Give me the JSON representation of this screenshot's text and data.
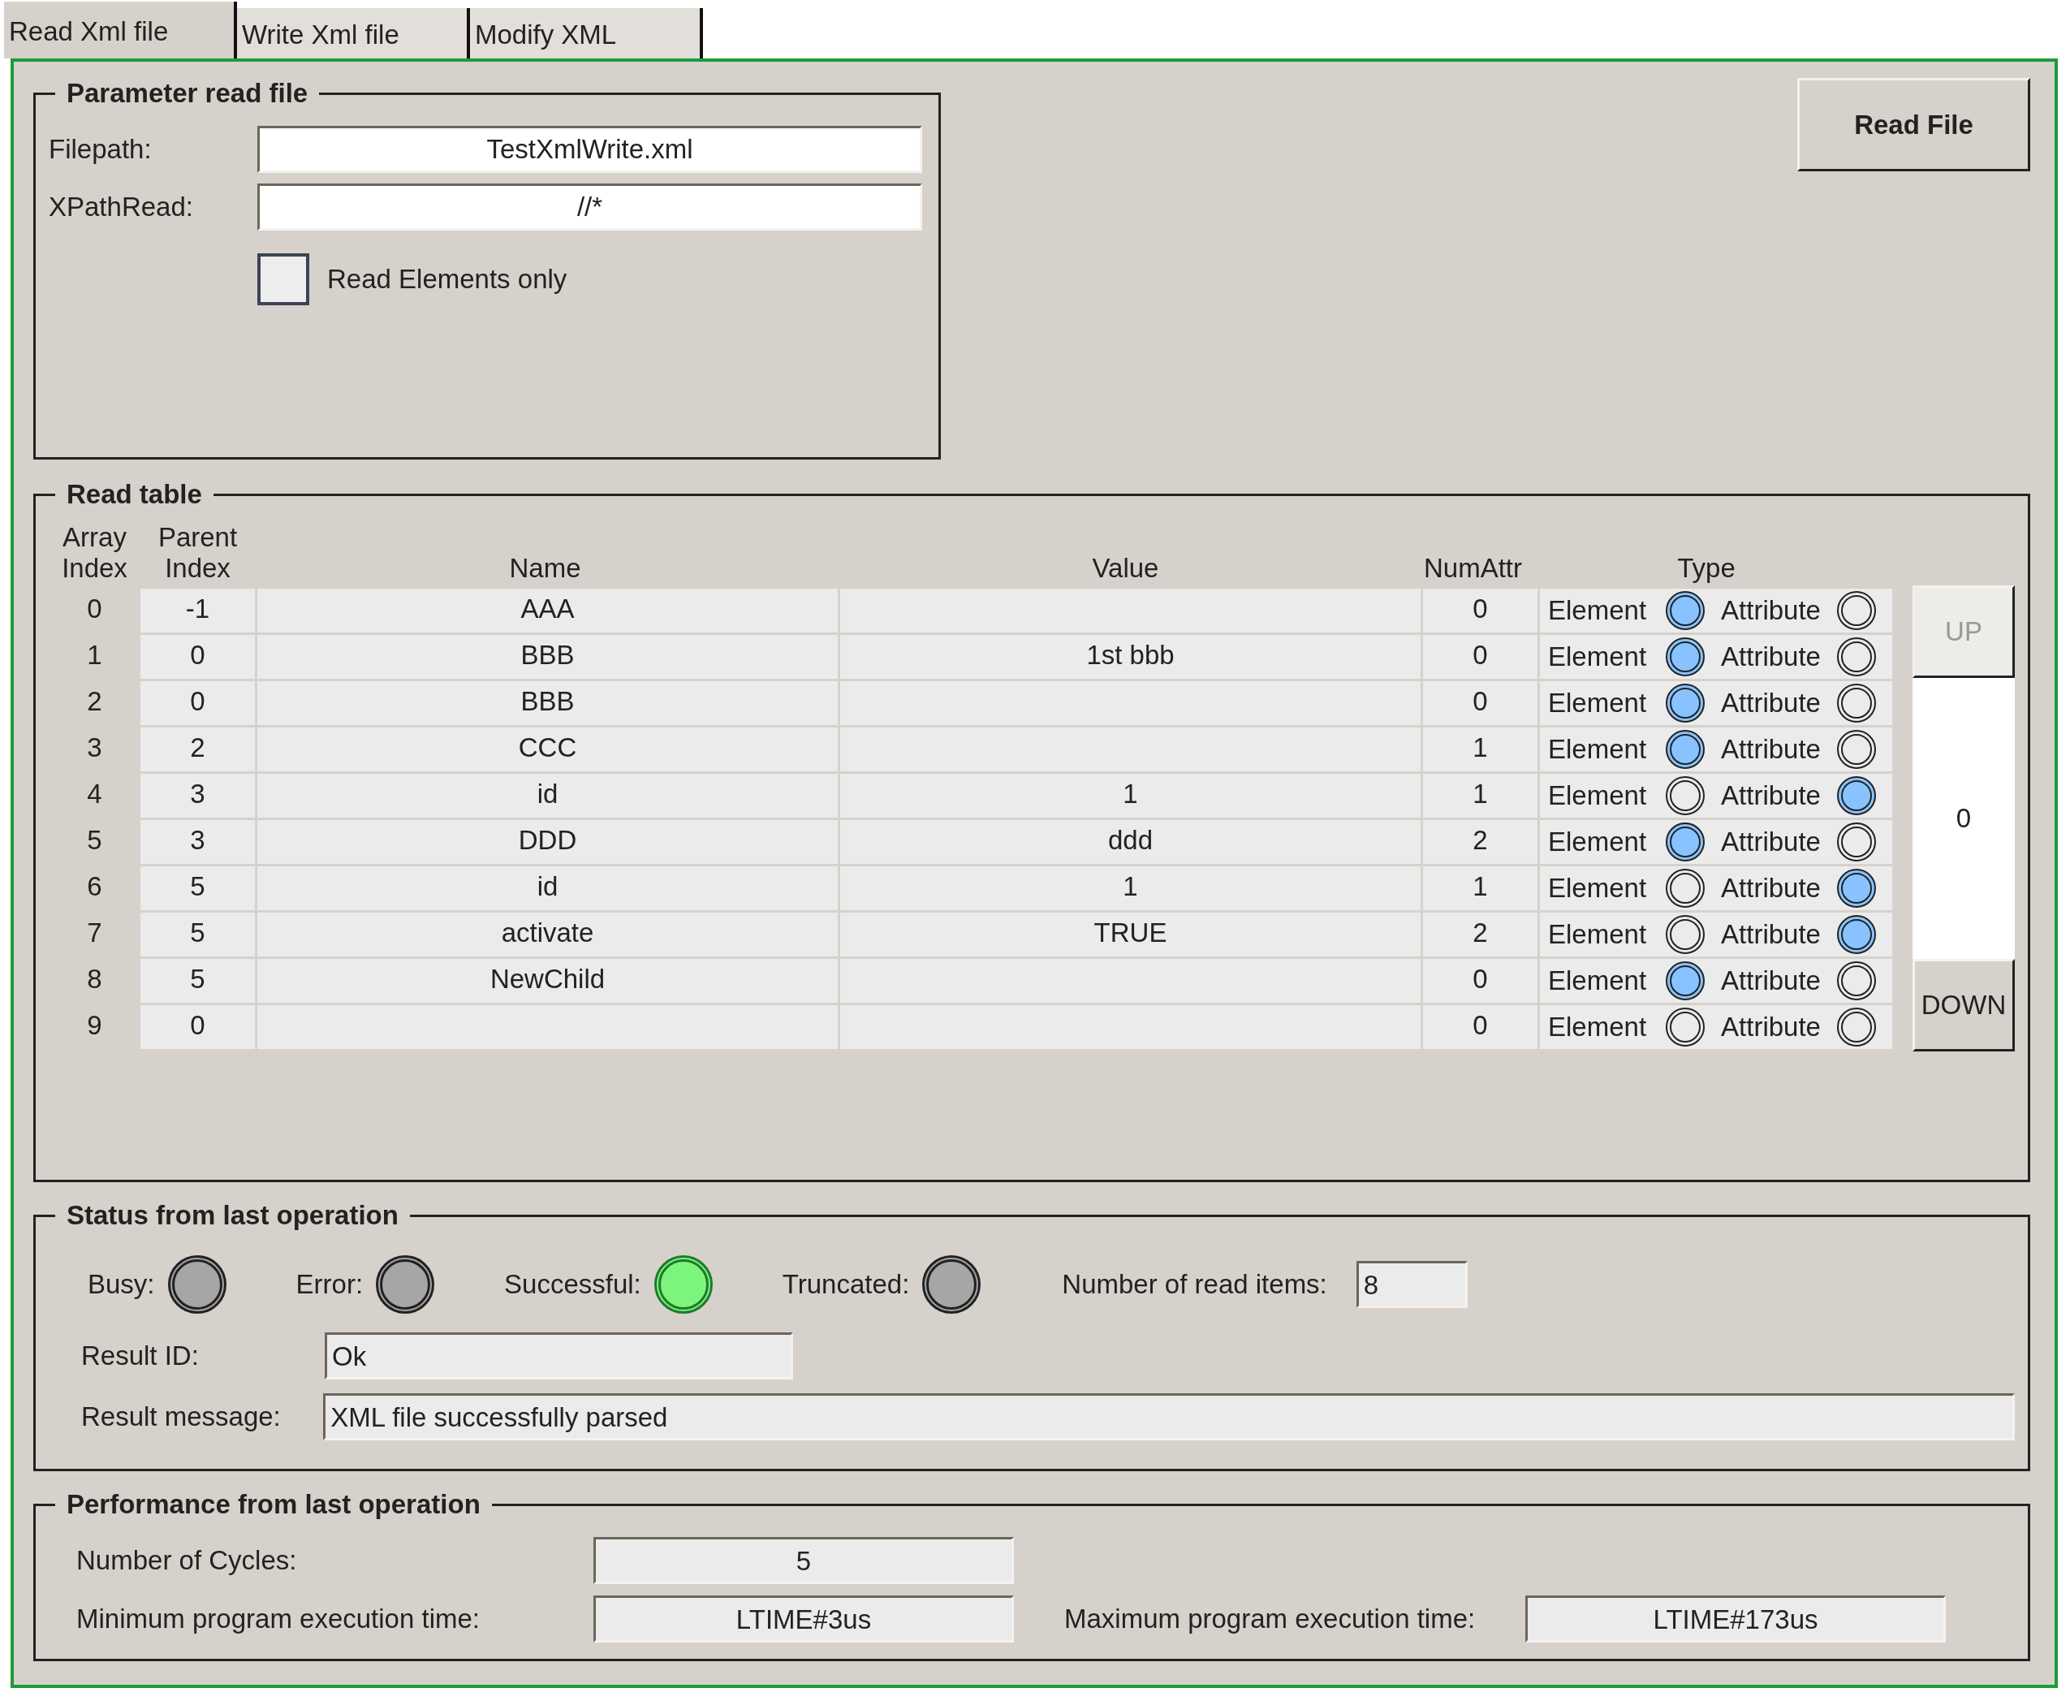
{
  "tabs": [
    {
      "label": "Read Xml file",
      "selected": true
    },
    {
      "label": "Write Xml file",
      "selected": false
    },
    {
      "label": "Modify XML",
      "selected": false
    }
  ],
  "parameter_group": {
    "title": "Parameter read file",
    "fields": [
      {
        "label": "Filepath:",
        "value": "TestXmlWrite.xml"
      },
      {
        "label": "XPathRead:",
        "value": "//*"
      }
    ],
    "checkbox": {
      "label": "Read Elements only",
      "checked": false
    }
  },
  "read_file_button": "Read File",
  "read_table": {
    "title": "Read table",
    "columns": [
      "Array Index",
      "Parent Index",
      "Name",
      "Value",
      "NumAttr",
      "Type"
    ],
    "rows": [
      {
        "index": "0",
        "parent": "-1",
        "name": "AAA",
        "num_attr": "0",
        "type_options": [
          {
            "label": "Element",
            "selected": true
          },
          {
            "label": "Attribute",
            "selected": false
          }
        ]
      },
      {
        "index": "1",
        "parent": "0",
        "name": "BBB",
        "value": "1st bbb",
        "num_attr": "0",
        "type_options": [
          {
            "label": "Element",
            "selected": true
          },
          {
            "label": "Attribute",
            "selected": false
          }
        ]
      },
      {
        "index": "2",
        "parent": "0",
        "name": "BBB",
        "num_attr": "0",
        "type_options": [
          {
            "label": "Element",
            "selected": true
          },
          {
            "label": "Attribute",
            "selected": false
          }
        ]
      },
      {
        "index": "3",
        "parent": "2",
        "name": "CCC",
        "num_attr": "1",
        "type_options": [
          {
            "label": "Element",
            "selected": true
          },
          {
            "label": "Attribute",
            "selected": false
          }
        ]
      },
      {
        "index": "4",
        "parent": "3",
        "name": "id",
        "value": "1",
        "num_attr": "1",
        "type_options": [
          {
            "label": "Element",
            "selected": false
          },
          {
            "label": "Attribute",
            "selected": true
          }
        ]
      },
      {
        "index": "5",
        "parent": "3",
        "name": "DDD",
        "value": "ddd",
        "num_attr": "2",
        "type_options": [
          {
            "label": "Element",
            "selected": true
          },
          {
            "label": "Attribute",
            "selected": false
          }
        ]
      },
      {
        "index": "6",
        "parent": "5",
        "name": "id",
        "value": "1",
        "num_attr": "1",
        "type_options": [
          {
            "label": "Element",
            "selected": false
          },
          {
            "label": "Attribute",
            "selected": true
          }
        ]
      },
      {
        "index": "7",
        "parent": "5",
        "name": "activate",
        "value": "TRUE",
        "num_attr": "2",
        "type_options": [
          {
            "label": "Element",
            "selected": false
          },
          {
            "label": "Attribute",
            "selected": true
          }
        ]
      },
      {
        "index": "8",
        "parent": "5",
        "name": "NewChild",
        "num_attr": "0",
        "type_options": [
          {
            "label": "Element",
            "selected": true
          },
          {
            "label": "Attribute",
            "selected": false
          }
        ]
      },
      {
        "index": "9",
        "parent": "0",
        "num_attr": "0",
        "type_options": [
          {
            "label": "Element",
            "selected": false
          },
          {
            "label": "Attribute",
            "selected": false
          }
        ]
      }
    ],
    "scroller": {
      "up": {
        "label": "UP",
        "disabled": true
      },
      "value": "0",
      "down": {
        "label": "DOWN",
        "disabled": false
      }
    }
  },
  "status_group": {
    "title": "Status from last operation",
    "lamps": [
      {
        "label": "Busy:",
        "on": false
      },
      {
        "label": "Error:",
        "on": false
      },
      {
        "label": "Successful:",
        "on": true
      },
      {
        "label": "Truncated:",
        "on": false
      }
    ],
    "read_items": {
      "label": "Number of read items:",
      "value": "8"
    },
    "result_id": {
      "label": "Result ID:",
      "value": "Ok"
    },
    "result_message": {
      "label": "Result message:",
      "value": "XML file successfully parsed"
    }
  },
  "performance_group": {
    "title": "Performance from last operation",
    "cycles": {
      "label": "Number of Cycles:",
      "value": "5"
    },
    "min_time": {
      "label": "Minimum program execution time:",
      "value": "LTIME#3us"
    },
    "max_time": {
      "label": "Maximum program execution time:",
      "value": "LTIME#173us"
    }
  }
}
